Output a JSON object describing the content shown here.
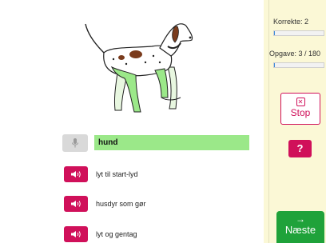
{
  "quiz": {
    "answer_value": "hund",
    "hints": [
      {
        "label": "lyt til start-lyd"
      },
      {
        "label": "husdyr som gør"
      },
      {
        "label": "lyt og gentag"
      }
    ]
  },
  "sidebar": {
    "correct_label": "Korrekte: 2",
    "correct_progress": 0.02,
    "task_label": "Opgave: 3 / 180",
    "task_progress": 0.017,
    "stop_label": "Stop",
    "help_label": "?",
    "next_label": "Næste"
  },
  "colors": {
    "accent": "#d0105a",
    "answer_bg": "#9be889",
    "next_bg": "#1fa23a",
    "sidebar_bg": "#fbf8d6"
  },
  "icons": {
    "picture": "dog-illustration",
    "mic": "microphone-icon",
    "sound": "speaker-icon",
    "stop": "close-box-icon",
    "next": "arrow-right-icon"
  }
}
